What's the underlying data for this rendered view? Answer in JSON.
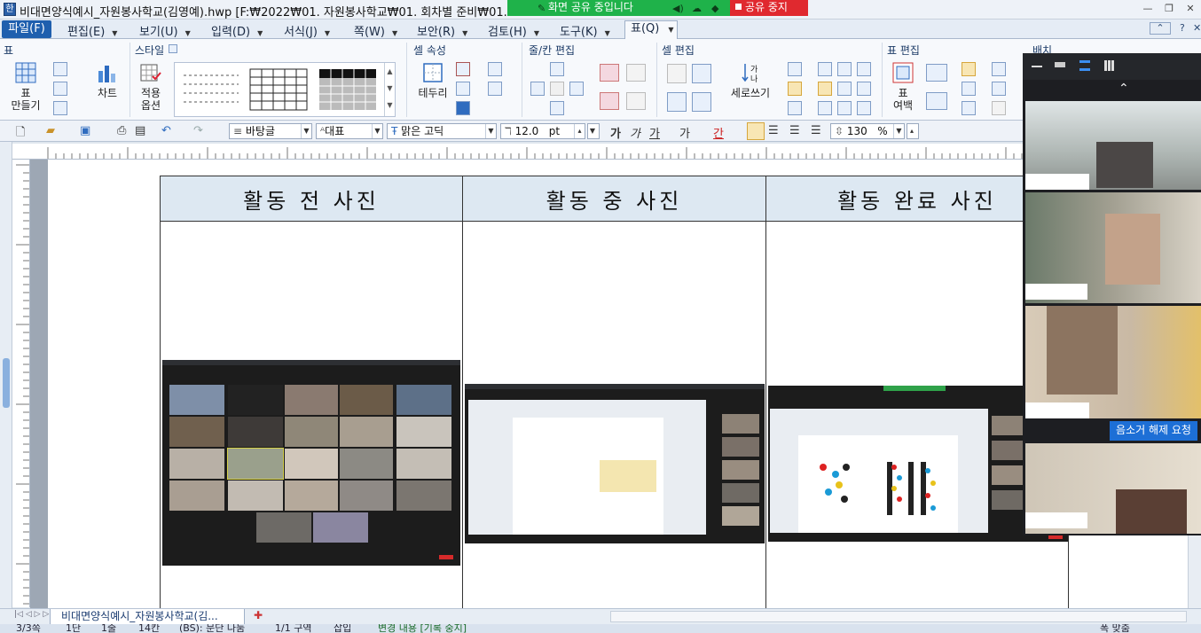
{
  "window": {
    "title": "비대면양식예시_자원봉사학교(김영예).hwp [F:₩2022₩01. 자원봉사학교₩01. 회차별 준비₩01. 202",
    "controls": [
      "—",
      "❐",
      "✕"
    ]
  },
  "screen_share": {
    "status_text": "화면 공유 중입니다",
    "stop_label": "공유 중지"
  },
  "menu": {
    "items": [
      "파일(F)",
      "편집(E)",
      "보기(U)",
      "입력(D)",
      "서식(J)",
      "쪽(W)",
      "보안(R)",
      "검토(H)",
      "도구(K)",
      "표(Q)"
    ],
    "right_controls": [
      "⌃",
      "?",
      "✕"
    ]
  },
  "ribbon": {
    "groups": [
      "표",
      "스타일",
      "셀 속성",
      "줄/칸 편집",
      "셀 편집",
      "표 편집",
      "배치"
    ],
    "buttons": {
      "make_table": "표\n만들기",
      "chart": "차트",
      "apply_options": "적용\n옵션",
      "border": "테두리",
      "vertical_write": "세로쓰기",
      "table_margin": "표\n여백"
    }
  },
  "toolbar": {
    "style_value": "바탕글",
    "language_value": "대표",
    "font_value": "맑은 고딕",
    "size_value": "12.0",
    "size_unit": "pt",
    "zoom_value": "130",
    "zoom_unit": "%",
    "format_buttons": [
      "가",
      "가",
      "가",
      "가",
      "간"
    ]
  },
  "document": {
    "headers": [
      "활동 전 사진",
      "활동 중 사진",
      "활동 완료 사진"
    ]
  },
  "tabbar": {
    "doc_tab": "비대면양식예시_자원봉사학교(김..."
  },
  "statusbar": {
    "items": [
      "3/3쪽",
      "1단",
      "1줄",
      "14칸",
      "(BS): 문단 나눔",
      "1/1 구역",
      "삽입",
      "변경 내용 [기록 중지]",
      "폭 맞춤"
    ]
  },
  "zoom_panel": {
    "unmute_request": "음소거 해제 요청"
  },
  "colors": {
    "accent": "#1f5fae",
    "share_green": "#1fb24a",
    "stop_red": "#e0292f",
    "header_fill": "#dde8f2"
  }
}
